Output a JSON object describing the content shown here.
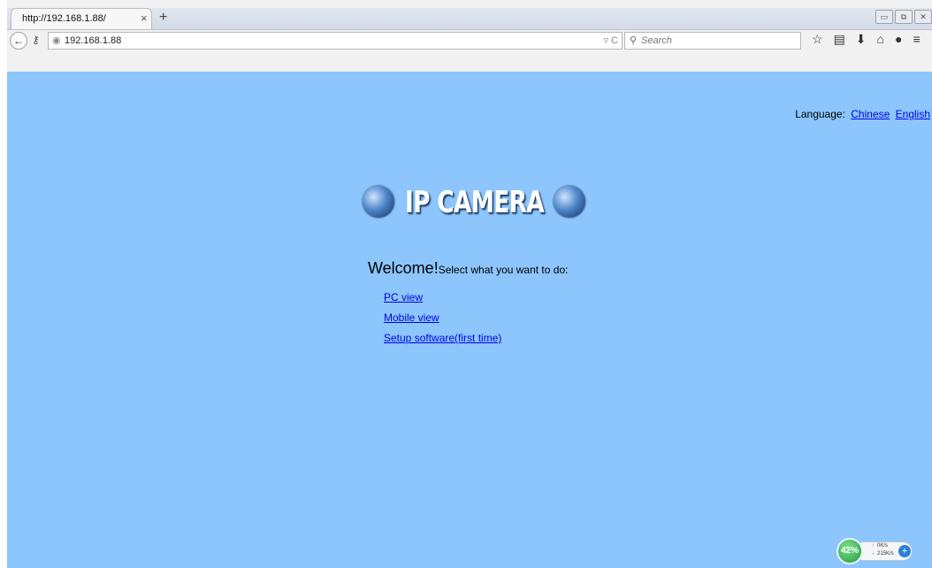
{
  "browser": {
    "tab_title": "http://192.168.1.88/",
    "tab_close_icon": "close-icon",
    "new_tab_icon": "plus-icon",
    "url": "192.168.1.88",
    "search_placeholder": "Search",
    "toolbar_icons": [
      "star-icon",
      "reading-list-icon",
      "download-icon",
      "home-icon",
      "chat-icon",
      "menu-icon"
    ]
  },
  "page": {
    "background_color": "#8cc6fc",
    "language_label": "Language:",
    "language_options": [
      "Chinese",
      "English"
    ],
    "logo_text": "IP CAMERA",
    "welcome_big": "Welcome!",
    "welcome_small": "Select what you want to do:",
    "links": [
      "PC view",
      "Mobile view",
      "Setup software(first time)"
    ]
  },
  "widget": {
    "percent": "42%",
    "upload": "0K/s",
    "download": "215K/s"
  }
}
